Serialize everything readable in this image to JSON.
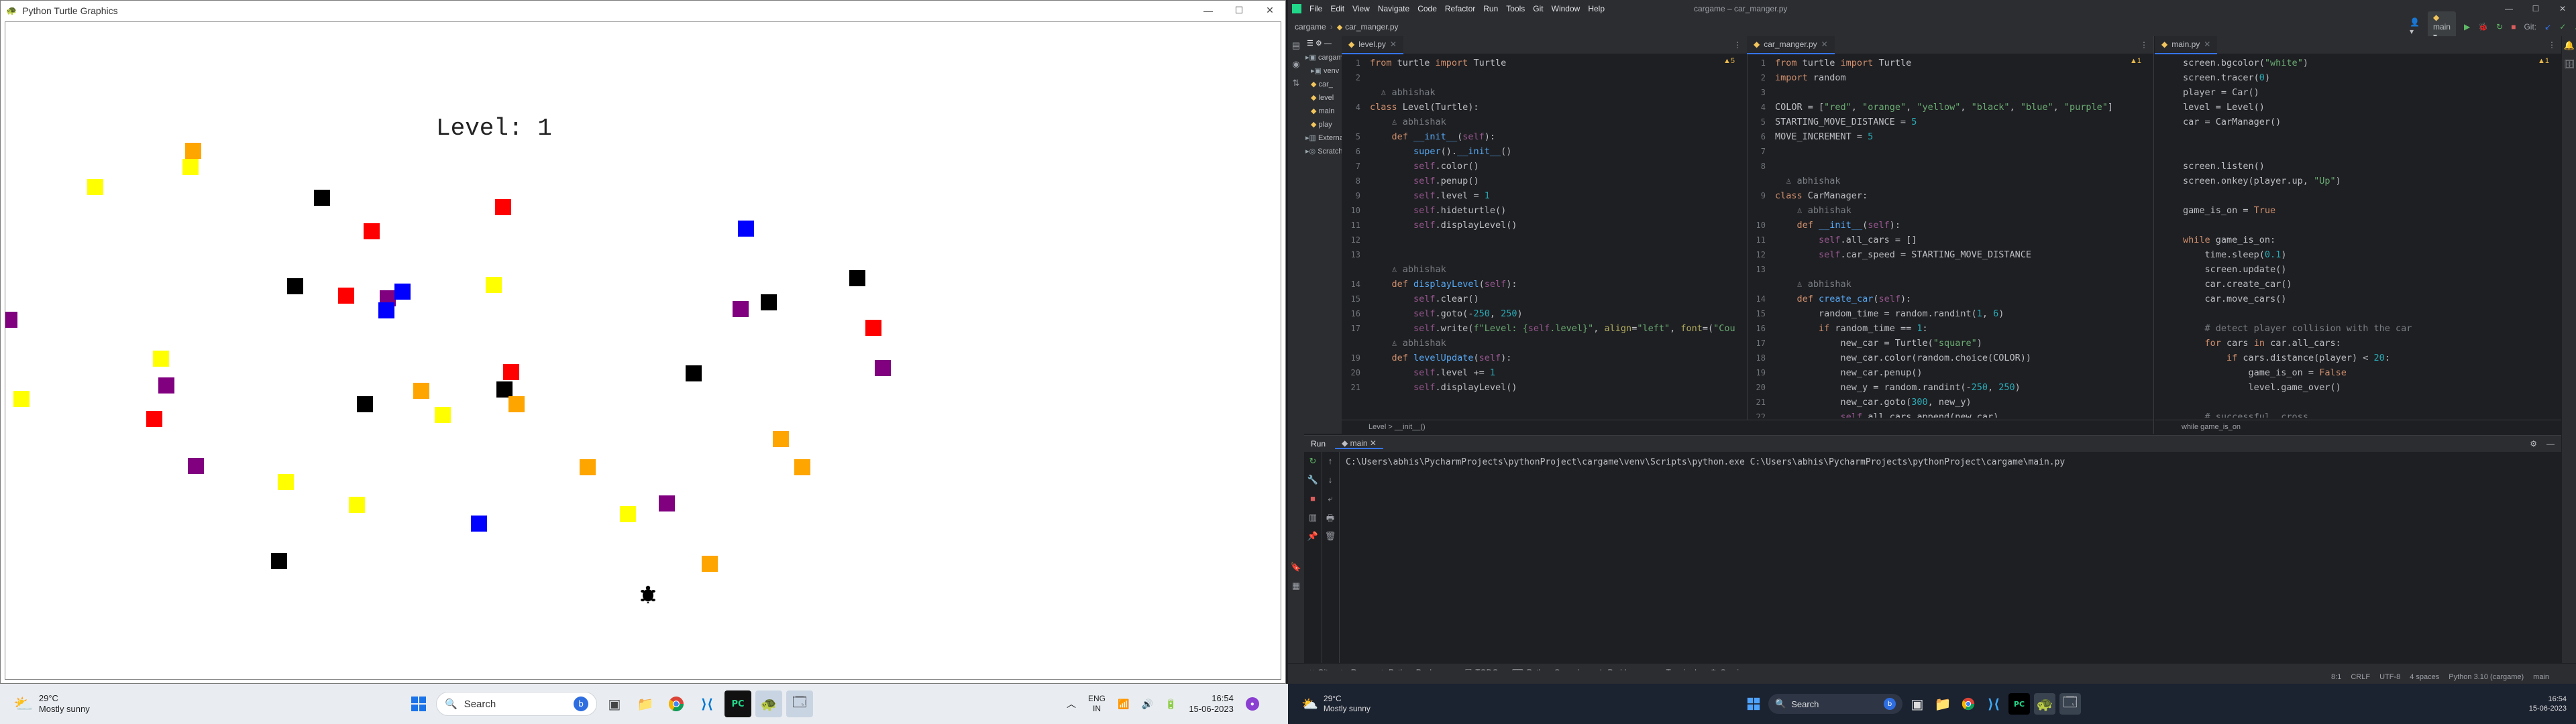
{
  "turtle_window": {
    "title": "Python Turtle Graphics",
    "level_text": "Level: 1",
    "colors": {
      "red": "#ff0000",
      "orange": "#ffa500",
      "yellow": "#ffff00",
      "black": "#000000",
      "blue": "#0000ff",
      "purple": "#800080"
    },
    "cars": [
      {
        "color": "orange"
      },
      {
        "color": "yellow"
      },
      {
        "color": "yellow"
      },
      {
        "color": "black"
      },
      {
        "color": "red"
      },
      {
        "color": "red"
      },
      {
        "color": "blue"
      },
      {
        "color": "black"
      },
      {
        "color": "red"
      },
      {
        "color": "purple"
      },
      {
        "color": "blue"
      },
      {
        "color": "blue"
      },
      {
        "color": "yellow"
      },
      {
        "color": "black"
      },
      {
        "color": "purple"
      },
      {
        "color": "black"
      },
      {
        "color": "red"
      },
      {
        "color": "purple"
      },
      {
        "color": "yellow"
      },
      {
        "color": "purple"
      },
      {
        "color": "yellow"
      },
      {
        "color": "orange"
      },
      {
        "color": "red"
      },
      {
        "color": "black"
      },
      {
        "color": "orange"
      },
      {
        "color": "black"
      },
      {
        "color": "yellow"
      },
      {
        "color": "red"
      },
      {
        "color": "purple"
      },
      {
        "color": "purple"
      },
      {
        "color": "black"
      },
      {
        "color": "orange"
      },
      {
        "color": "orange"
      },
      {
        "color": "orange"
      },
      {
        "color": "yellow"
      },
      {
        "color": "yellow"
      },
      {
        "color": "yellow"
      },
      {
        "color": "blue"
      },
      {
        "color": "black"
      },
      {
        "color": "orange"
      },
      {
        "color": "purple"
      }
    ]
  },
  "left_taskbar": {
    "weather_temp": "29°C",
    "weather_desc": "Mostly sunny",
    "search_label": "Search",
    "lang_line1": "ENG",
    "lang_line2": "IN",
    "time": "16:54",
    "date": "15-06-2023"
  },
  "right_taskbar": {
    "weather_temp": "29°C",
    "weather_desc": "Mostly sunny",
    "search_label": "Search",
    "time": "16:54",
    "date": "15-06-2023"
  },
  "ide": {
    "title": "cargame – car_manger.py",
    "menu": [
      "File",
      "Edit",
      "View",
      "Navigate",
      "Code",
      "Refactor",
      "Run",
      "Tools",
      "Git",
      "Window",
      "Help"
    ],
    "breadcrumb": [
      "cargame",
      "car_manger.py"
    ],
    "branch": "main",
    "run_config": "main",
    "project_tree": [
      "cargame",
      "venv",
      "car_",
      "level",
      "main",
      "play",
      "External",
      "Scratch"
    ],
    "editors": [
      {
        "file": "level.py",
        "inspection": "▲5",
        "status_breadcrumb": "Level  >  __init__()",
        "lines": [
          {
            "n": "1",
            "html": "<span class='kw'>from</span> turtle <span class='kw'>import</span> Turtle"
          },
          {
            "n": "2",
            "html": ""
          },
          {
            "n": "",
            "html": "<span class='cm'>  ♙ abhishak</span>"
          },
          {
            "n": "4",
            "html": "<span class='kw'>class</span> Level(Turtle):"
          },
          {
            "n": "",
            "html": "<span class='cm'>    ♙ abhishak</span>"
          },
          {
            "n": "5",
            "html": "    <span class='kw'>def</span> <span class='fn'>__init__</span>(<span class='self'>self</span>):"
          },
          {
            "n": "6",
            "html": "        <span class='fn'>super</span>().<span class='fn'>__init__</span>()"
          },
          {
            "n": "7",
            "html": "        <span class='self'>self</span>.color()"
          },
          {
            "n": "8",
            "html": "        <span class='self'>self</span>.penup()"
          },
          {
            "n": "9",
            "html": "        <span class='self'>self</span>.level = <span class='num'>1</span>"
          },
          {
            "n": "10",
            "html": "        <span class='self'>self</span>.hideturtle()"
          },
          {
            "n": "11",
            "html": "        <span class='self'>self</span>.displayLevel()"
          },
          {
            "n": "12",
            "html": ""
          },
          {
            "n": "13",
            "html": ""
          },
          {
            "n": "",
            "html": "<span class='cm'>    ♙ abhishak</span>"
          },
          {
            "n": "14",
            "html": "    <span class='kw'>def</span> <span class='fn'>displayLevel</span>(<span class='self'>self</span>):"
          },
          {
            "n": "15",
            "html": "        <span class='self'>self</span>.clear()"
          },
          {
            "n": "16",
            "html": "        <span class='self'>self</span>.goto(-<span class='num'>250</span>, <span class='num'>250</span>)"
          },
          {
            "n": "17",
            "html": "        <span class='self'>self</span>.write(<span class='str'>f\"Level: {</span><span class='self'>self</span><span class='str'>.level}\"</span>, <span class='param'>align</span>=<span class='str'>\"left\"</span>, <span class='param'>font</span>=(<span class='str'>\"Cou</span>"
          },
          {
            "n": "",
            "html": "<span class='cm'>    ♙ abhishak</span>"
          },
          {
            "n": "19",
            "html": "    <span class='kw'>def</span> <span class='fn'>levelUpdate</span>(<span class='self'>self</span>):"
          },
          {
            "n": "20",
            "html": "        <span class='self'>self</span>.level += <span class='num'>1</span>"
          },
          {
            "n": "21",
            "html": "        <span class='self'>self</span>.displayLevel()"
          }
        ]
      },
      {
        "file": "car_manger.py",
        "inspection": "▲1",
        "status_breadcrumb": "",
        "lines": [
          {
            "n": "1",
            "html": "<span class='kw'>from</span> turtle <span class='kw'>import</span> Turtle"
          },
          {
            "n": "2",
            "html": "<span class='kw'>import</span> random"
          },
          {
            "n": "3",
            "html": ""
          },
          {
            "n": "4",
            "html": "COLOR = [<span class='str'>\"red\"</span>, <span class='str'>\"orange\"</span>, <span class='str'>\"yellow\"</span>, <span class='str'>\"black\"</span>, <span class='str'>\"blue\"</span>, <span class='str'>\"purple\"</span>]"
          },
          {
            "n": "5",
            "html": "STARTING_MOVE_DISTANCE = <span class='num'>5</span>"
          },
          {
            "n": "6",
            "html": "MOVE_INCREMENT = <span class='num'>5</span>"
          },
          {
            "n": "7",
            "html": ""
          },
          {
            "n": "8",
            "html": ""
          },
          {
            "n": "",
            "html": "<span class='cm'>  ♙ abhishak</span>"
          },
          {
            "n": "9",
            "html": "<span class='kw'>class</span> CarManager:"
          },
          {
            "n": "",
            "html": "<span class='cm'>    ♙ abhishak</span>"
          },
          {
            "n": "10",
            "html": "    <span class='kw'>def</span> <span class='fn'>__init__</span>(<span class='self'>self</span>):"
          },
          {
            "n": "11",
            "html": "        <span class='self'>self</span>.all_cars = []"
          },
          {
            "n": "12",
            "html": "        <span class='self'>self</span>.car_speed = STARTING_MOVE_DISTANCE"
          },
          {
            "n": "13",
            "html": ""
          },
          {
            "n": "",
            "html": "<span class='cm'>    ♙ abhishak</span>"
          },
          {
            "n": "14",
            "html": "    <span class='kw'>def</span> <span class='fn'>create_car</span>(<span class='self'>self</span>):"
          },
          {
            "n": "15",
            "html": "        random_time = random.randint(<span class='num'>1</span>, <span class='num'>6</span>)"
          },
          {
            "n": "16",
            "html": "        <span class='kw'>if</span> random_time == <span class='num'>1</span>:"
          },
          {
            "n": "17",
            "html": "            new_car = Turtle(<span class='str'>\"square\"</span>)"
          },
          {
            "n": "18",
            "html": "            new_car.color(random.choice(COLOR))"
          },
          {
            "n": "19",
            "html": "            new_car.penup()"
          },
          {
            "n": "20",
            "html": "            new_y = random.randint(-<span class='num'>250</span>, <span class='num'>250</span>)"
          },
          {
            "n": "21",
            "html": "            new_car.goto(<span class='num'>300</span>, new_y)"
          },
          {
            "n": "22",
            "html": "            <span class='self'>self</span>.all_cars.append(new_car)"
          }
        ]
      },
      {
        "file": "main.py",
        "inspection": "▲1",
        "status_breadcrumb": "while game_is_on",
        "lines": [
          {
            "n": "",
            "html": "screen.bgcolor(<span class='str'>\"white\"</span>)"
          },
          {
            "n": "",
            "html": "screen.tracer(<span class='num'>0</span>)"
          },
          {
            "n": "",
            "html": "player = Car()"
          },
          {
            "n": "",
            "html": "level = Level()"
          },
          {
            "n": "",
            "html": "car = CarManager()"
          },
          {
            "n": "",
            "html": ""
          },
          {
            "n": "",
            "html": ""
          },
          {
            "n": "",
            "html": "screen.listen()"
          },
          {
            "n": "",
            "html": "screen.onkey(player.up, <span class='str'>\"Up\"</span>)"
          },
          {
            "n": "",
            "html": ""
          },
          {
            "n": "",
            "html": "game_is_on = <span class='kw'>True</span>"
          },
          {
            "n": "",
            "html": ""
          },
          {
            "n": "",
            "html": "<span class='kw'>while</span> game_is_on:"
          },
          {
            "n": "",
            "html": "    time.sleep(<span class='num'>0.1</span>)"
          },
          {
            "n": "",
            "html": "    screen.update()"
          },
          {
            "n": "",
            "html": "    car.create_car()"
          },
          {
            "n": "",
            "html": "    car.move_cars()"
          },
          {
            "n": "",
            "html": ""
          },
          {
            "n": "",
            "html": "    <span class='cm'># detect player collision with the car</span>"
          },
          {
            "n": "",
            "html": "    <span class='kw'>for</span> cars <span class='kw'>in</span> car.all_cars:"
          },
          {
            "n": "",
            "html": "        <span class='kw'>if</span> cars.distance(player) &lt; <span class='num'>20</span>:"
          },
          {
            "n": "",
            "html": "            game_is_on = <span class='kw'>False</span>"
          },
          {
            "n": "",
            "html": "            level.game_over()"
          },
          {
            "n": "",
            "html": ""
          },
          {
            "n": "",
            "html": "    <span class='cm'># successful  cross</span>"
          }
        ]
      }
    ],
    "main_gutter_numbers": [
      "",
      "",
      "",
      "",
      "",
      "",
      "",
      "",
      "",
      "",
      "",
      "",
      "",
      "",
      "",
      "",
      "",
      "",
      "",
      "",
      "",
      "",
      "",
      "",
      ""
    ],
    "run_panel": {
      "tab_label": "Run",
      "config_tab": "main",
      "command": "C:\\Users\\abhis\\PycharmProjects\\pythonProject\\cargame\\venv\\Scripts\\python.exe C:\\Users\\abhis\\PycharmProjects\\pythonProject\\cargame\\main.py"
    },
    "bottom_tools": [
      "Git",
      "Run",
      "Python Packages",
      "TODO",
      "Python Console",
      "Problems",
      "Terminal",
      "Services"
    ],
    "status_bar": [
      "8:1",
      "CRLF",
      "UTF-8",
      "4 spaces",
      "Python 3.10 (cargame)",
      "main"
    ]
  }
}
